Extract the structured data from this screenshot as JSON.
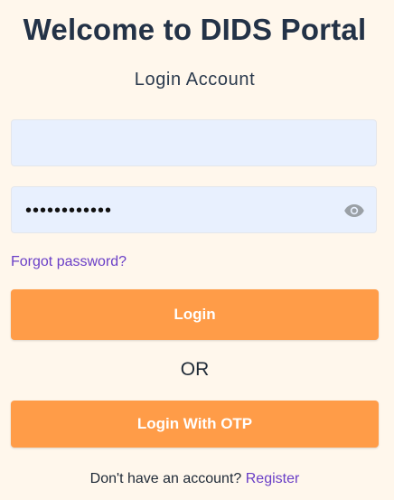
{
  "header": {
    "title": "Welcome to DIDS Portal",
    "subtitle": "Login Account"
  },
  "form": {
    "username_value": "",
    "password_mask": "••••••••••••",
    "forgot_label": "Forgot password?",
    "login_label": "Login",
    "or_label": "OR",
    "otp_label": "Login With OTP"
  },
  "footer": {
    "prompt": "Don't have an account? ",
    "register_label": "Register"
  },
  "icons": {
    "password_toggle": "eye-icon"
  },
  "colors": {
    "background": "#fff7ec",
    "accent": "#ff9c48",
    "input_bg": "#e8f0fe",
    "link": "#6a3fc7"
  }
}
